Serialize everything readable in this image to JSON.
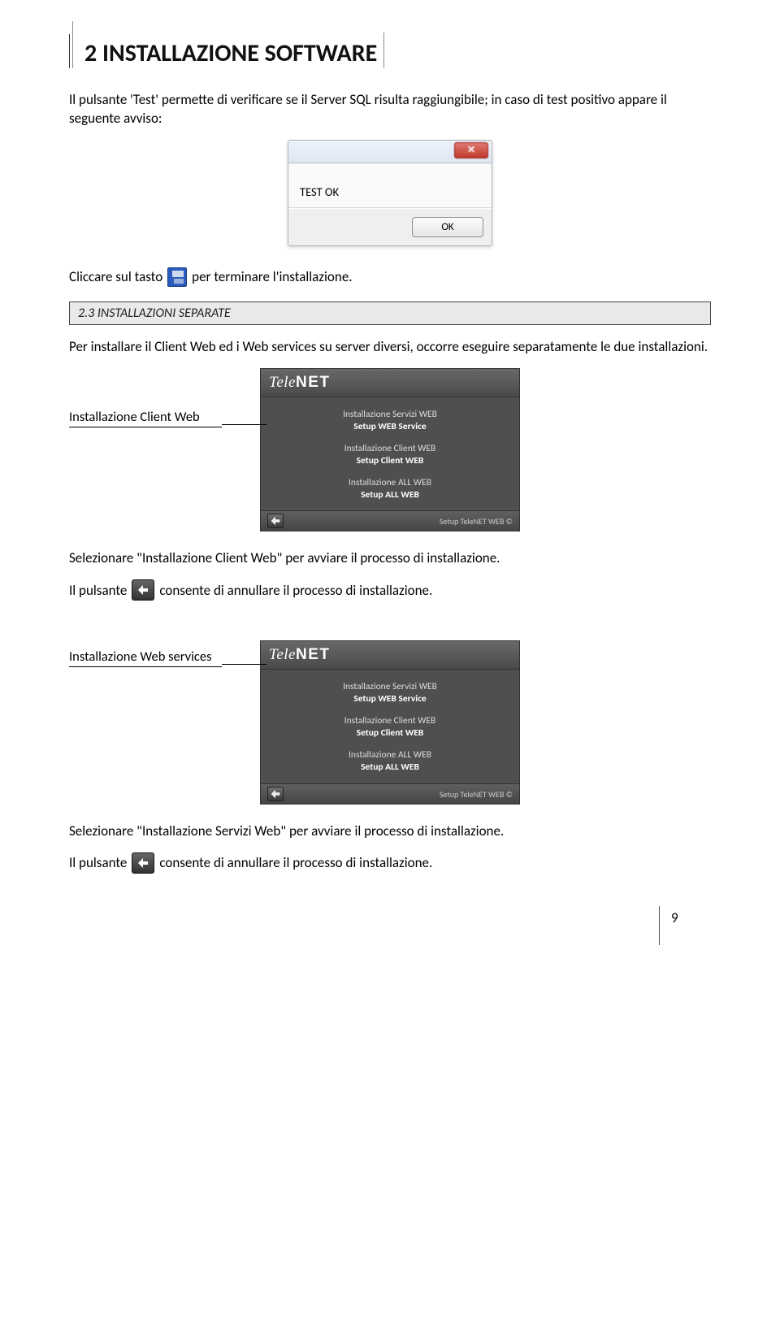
{
  "section_title": "2 INSTALLAZIONE SOFTWARE",
  "para1": "Il pulsante 'Test' permette di verificare se il Server SQL risulta raggiungibile; in caso di test positivo appare il seguente avviso:",
  "dialog": {
    "close": "✕",
    "message": "TEST OK",
    "ok": "OK"
  },
  "line_click": {
    "pre": "Cliccare sul tasto",
    "post": "per terminare l'installazione."
  },
  "sub_heading": "2.3 INSTALLAZIONI SEPARATE",
  "para2": "Per installare il Client Web ed i Web services su server diversi, occorre eseguire separatamente le due installazioni.",
  "callout1": "Installazione Client Web",
  "installer": {
    "brand": "TeleNET",
    "item1a": "Installazione Servizi WEB",
    "item1b": "Setup WEB Service",
    "item2a": "Installazione Client WEB",
    "item2b": "Setup Client WEB",
    "item3a": "Installazione ALL WEB",
    "item3b": "Setup ALL WEB",
    "footer": "Setup TeleNET WEB ©"
  },
  "para3": "Selezionare \"Installazione Client Web\" per avviare il processo di installazione.",
  "cancel": {
    "pre": "Il pulsante",
    "post": "consente di annullare il processo di installazione."
  },
  "callout2": "Installazione Web services",
  "para4": "Selezionare \"Installazione Servizi Web\" per avviare il processo di installazione.",
  "page_number": "9"
}
